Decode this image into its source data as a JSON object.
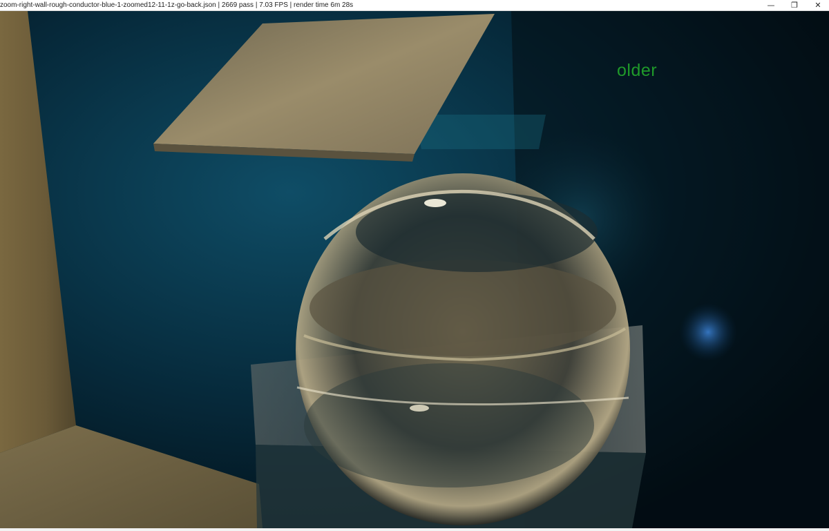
{
  "window": {
    "title": "zoom-right-wall-rough-conductor-blue-1-zoomed12-11-1z-go-back.json  |  2669 pass  |  7.03 FPS  |  render time 6m 28s",
    "controls": {
      "minimize_glyph": "—",
      "restore_glyph": "❐",
      "close_glyph": "✕"
    }
  },
  "viewport": {
    "overlay_label": "older",
    "overlay_color": "#1f9a2a",
    "scene_palette": {
      "background": "#041620",
      "left_wall": "#6b5a36",
      "teal_glow": "#0e5a6e",
      "plate": "#8a7a5a",
      "glass_highlight": "#e8e0c8"
    }
  }
}
